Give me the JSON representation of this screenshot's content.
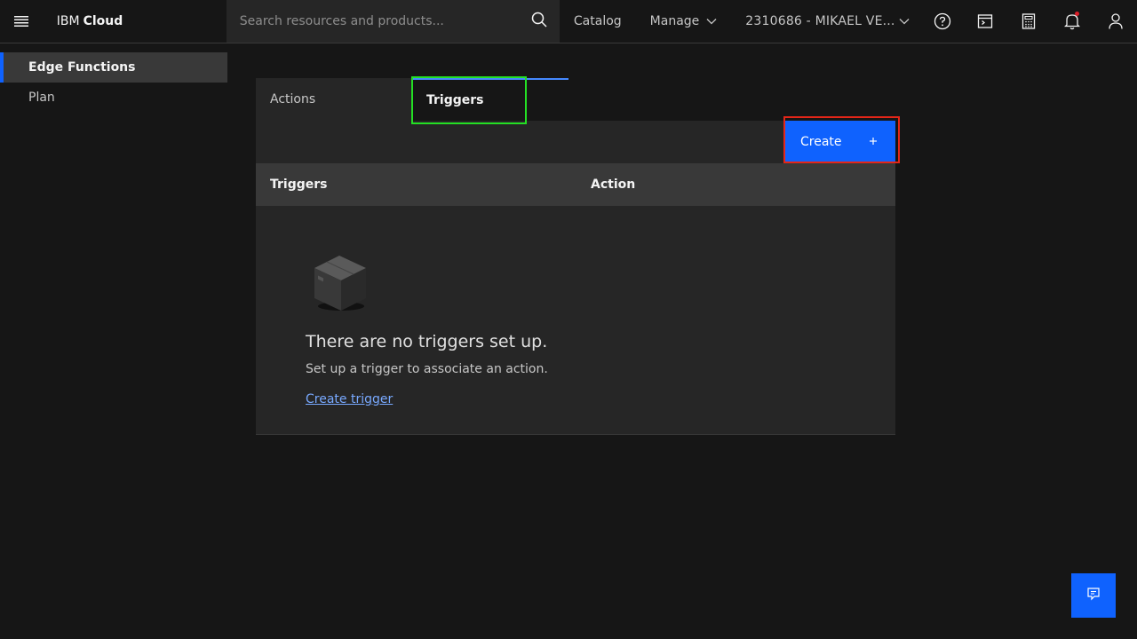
{
  "header": {
    "brand_prefix": "IBM",
    "brand_name": "Cloud",
    "search_placeholder": "Search resources and products...",
    "catalog": "Catalog",
    "manage": "Manage",
    "account": "2310686 - MIKAEL VE..."
  },
  "sidebar": {
    "items": [
      {
        "label": "Edge Functions"
      },
      {
        "label": "Plan"
      }
    ]
  },
  "tabs": [
    {
      "label": "Actions"
    },
    {
      "label": "Triggers"
    }
  ],
  "toolbar": {
    "create_label": "Create"
  },
  "table": {
    "columns": [
      "Triggers",
      "Action"
    ]
  },
  "empty_state": {
    "title": "There are no triggers set up.",
    "description": "Set up a trigger to associate an action.",
    "link": "Create trigger"
  },
  "colors": {
    "primary": "#0f62fe",
    "highlight_green": "#24e024",
    "highlight_red": "#e42618"
  }
}
